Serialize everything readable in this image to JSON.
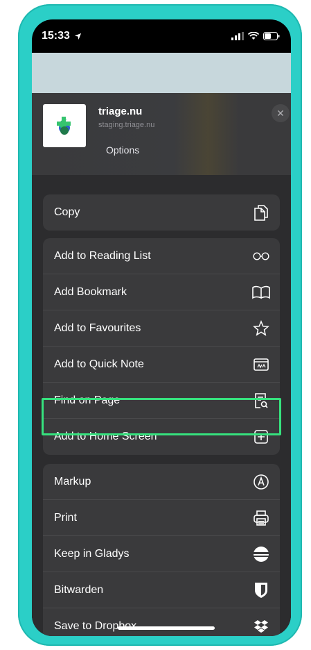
{
  "status_bar": {
    "time": "15:33"
  },
  "share_sheet": {
    "site_title": "triage.nu",
    "site_url": "staging.triage.nu",
    "options_label": "Options",
    "close_label": "✕"
  },
  "actions": {
    "copy": {
      "label": "Copy",
      "icon": "copy-icon"
    },
    "group2": [
      {
        "label": "Add to Reading List",
        "icon": "glasses-icon"
      },
      {
        "label": "Add Bookmark",
        "icon": "book-icon"
      },
      {
        "label": "Add to Favourites",
        "icon": "star-icon"
      },
      {
        "label": "Add to Quick Note",
        "icon": "quick-note-icon"
      },
      {
        "label": "Find on Page",
        "icon": "find-on-page-icon"
      },
      {
        "label": "Add to Home Screen",
        "icon": "add-square-icon"
      }
    ],
    "group3": [
      {
        "label": "Markup",
        "icon": "markup-icon"
      },
      {
        "label": "Print",
        "icon": "print-icon"
      },
      {
        "label": "Keep in Gladys",
        "icon": "gladys-icon"
      },
      {
        "label": "Bitwarden",
        "icon": "shield-icon"
      },
      {
        "label": "Save to Dropbox",
        "icon": "dropbox-icon"
      }
    ]
  },
  "colors": {
    "frame": "#2bcfc7",
    "highlight": "#36e27e",
    "sheet_bg": "#2c2c2e",
    "row_bg": "#3a3a3c"
  }
}
